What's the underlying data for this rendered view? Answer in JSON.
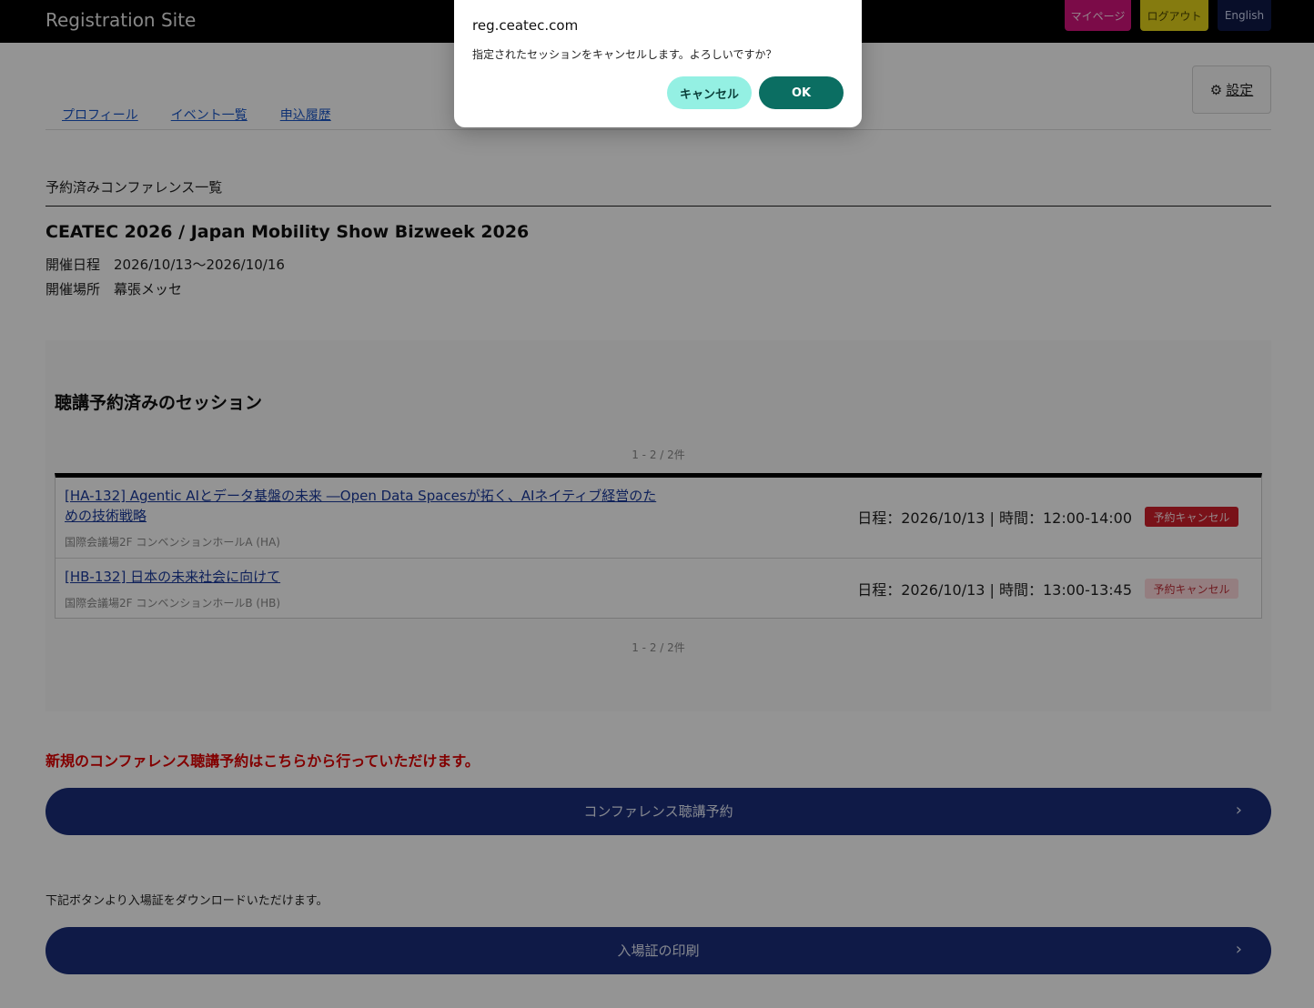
{
  "header": {
    "site_title": "Registration Site",
    "mypage": "マイページ",
    "logout": "ログアウト",
    "english": "English"
  },
  "settings": {
    "label": "設定",
    "icon": "gear-icon"
  },
  "tabs": [
    {
      "label": "プロフィール"
    },
    {
      "label": "イベント一覧"
    },
    {
      "label": "申込履歴"
    }
  ],
  "page": {
    "section_heading": "予約済みコンファレンス一覧",
    "event_title": "CEATEC 2026 / Japan Mobility Show Bizweek 2026",
    "date_label": "開催日程",
    "date_value": "2026/10/13〜2026/10/16",
    "place_label": "開催場所",
    "place_value": "幕張メッセ"
  },
  "sessions_panel": {
    "title": "聴講予約済みのセッション",
    "count_text": "1 - 2 / 2件",
    "rows": [
      {
        "title": "[HA-132] Agentic AIとデータ基盤の未来 ―Open Data Spacesが拓く、AIネイティブ経営のための技術戦略",
        "room": "国際会議場2F コンベンションホールA (HA)",
        "time": "日程：2026/10/13 | 時間：12:00-14:00",
        "cancel": "予約キャンセル"
      },
      {
        "title": "[HB-132] 日本の未来社会に向けて",
        "room": "国際会議場2F コンベンションホールB (HB)",
        "time": "日程：2026/10/13 | 時間：13:00-13:45",
        "cancel": "予約キャンセル"
      }
    ]
  },
  "footer": {
    "new_booking_notice": "新規のコンファレンス聴講予約はこちらから行っていただけます。",
    "conf_button": "コンファレンス聴講予約",
    "download_notice": "下記ボタンより入場証をダウンロードいただけます。",
    "print_button": "入場証の印刷",
    "chevron": "›"
  },
  "dialog": {
    "host": "reg.ceatec.com",
    "message": "指定されたセッションをキャンセルします。よろしいですか？",
    "cancel": "キャンセル",
    "ok": "OK"
  },
  "colors": {
    "topbar": "#000000",
    "mypage": "#d4137d",
    "logout": "#e5d51a",
    "english": "#0e1947",
    "primary_button": "#1a2e7a",
    "cancel_badge": "#d01f2b",
    "notice_red": "#e00000",
    "dialog_ok": "#0b6e62",
    "dialog_cancel": "#94f0e3"
  }
}
